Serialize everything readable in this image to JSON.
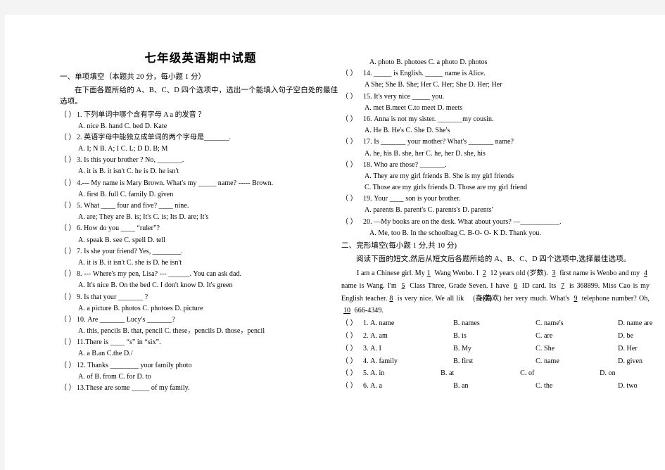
{
  "document": {
    "title": "七年级英语期中试题"
  },
  "section1": {
    "heading": "一、单项填空（本题共 20 分，每小题 1 分）",
    "instruction": "在下面各题所给的 A、B、C、D 四个选项中，选出一个能填入句子空白处的最佳选项。",
    "bracket": "（    ）",
    "questions": [
      {
        "num": "1.",
        "stem": "下列单词中哪个含有字母 A a 的发音 ？",
        "options": "A. nice          B. hand          C. bed              D. Kate"
      },
      {
        "num": "2.",
        "stem": "英语字母中能独立成单词的两个字母是_______.",
        "options": "A. I; N          B. A; I         C. L; D         D. B; M"
      },
      {
        "num": "3.",
        "stem": "Is this your brother ? No, _______.",
        "options": "A. it is          B. it isn't        C. he is       D. he isn't"
      },
      {
        "num": "4.---",
        "stem": "My name is Mary Brown. What's my _____ name?     ----- Brown.",
        "options": "A. first         B. full        C. family      D. given"
      },
      {
        "num": "5.",
        "stem": "What ____ four and five?      ____ nine.",
        "options": "A. are; They are     B. is; It's     C. is; Its     D. are; It's"
      },
      {
        "num": "6.",
        "stem": "How do you ____ “ruler”?",
        "options": "A. speak           B. see          C. spell        D. tell"
      },
      {
        "num": "7.",
        "stem": "Is she your friend? Yes, ________.",
        "options": "A. it is            B. it isn't         C. she is       D. he isn't"
      },
      {
        "num": "8. ---",
        "stem": "Where's my pen, Lisa?     --- ______. You can ask dad.",
        "options": "A. It's nice      B. On the bed    C. I don't know   D. It's green"
      },
      {
        "num": "9.",
        "stem": "Is that your _______ ?",
        "options": "A. a picture        B. photos       C. photoes        D. picture"
      },
      {
        "num": "10.",
        "stem": "Are _______ Lucy's _______?",
        "options": "A. this, pencils    B. that,  pencil     C. these，pencils    D. those，pencil"
      },
      {
        "num": "11.",
        "stem": "There is ____ “s” in “six”.",
        "options": "A. a              B.an          C.the            D./"
      },
      {
        "num": "12.",
        "stem": "Thanks ________ your family photo",
        "options": "A. of            B. from           C. for           D. to"
      },
      {
        "num": "13.",
        "stem": "These are some _____ of my family.",
        "options": "A. photo      B. photoes        C. a photo        D. photos"
      },
      {
        "num": "14.",
        "stem": "_____ is English.    _____ name is Alice.",
        "options": "A She; She           B. She; Her          C. Her; She      D. Her; Her"
      },
      {
        "num": "15.",
        "stem": "It's very nice _____ you.",
        "options": "A. met             B.meet         C.to meet               D. meets"
      },
      {
        "num": "16.",
        "stem": "Anna is not my sister. _______my cousin.",
        "options": "A. He     B. He's       C. She      D. She's"
      },
      {
        "num": "17.",
        "stem": "Is _______ your mother? What's _______ name?",
        "options": "A. he,  his       B. she,  her      C. he,  her       D. she,  his"
      },
      {
        "num": "18.",
        "stem": "Who are those? _______.",
        "options_line1": "A. They are my girl friends                B. She is my girl friends",
        "options_line2": "C. Those are my girls friends             D. Those are my girl friend"
      },
      {
        "num": "19.",
        "stem": "Your ____ son is your brother.",
        "options": "A. parents        B. parent's       C. parents's     D. parents'"
      },
      {
        "num": "20.",
        "stem": "—My books are on the desk. What about yours?       —___________.",
        "options": "A. Me, too    B. In the schoolbag   C. B-O- O- K     D. Thank you."
      }
    ]
  },
  "section2": {
    "heading": "二、完形填空(每小题 1 分,共 10 分)",
    "instruction": "阅读下面的短文,然后从短文后各题所给的 A、B、C、D 四个选项中,选择最佳选项。",
    "passage_line1_a": "I am a Chinese girl. My",
    "passage_blank1": "1",
    "passage_line1_b": "Wang Wenbo. I",
    "passage_blank2": "2",
    "passage_line1_c": "12 years old (岁数).",
    "passage_blank3": "3",
    "passage_line1_d": "first name is",
    "passage_line2_a": "Wenbo and my",
    "passage_blank4": "4",
    "passage_line2_b": "name is Wang. I'm",
    "passage_blank5": "5",
    "passage_line2_c": "Class Three, Grade Seven. I have",
    "passage_blank6": "6",
    "passage_line2_d": "ID card.",
    "passage_line3_a": "Its",
    "passage_blank7": "7",
    "passage_line3_b": "is 368899. Miss Cao is my English teacher.",
    "passage_blank8": "8",
    "passage_line3_c": "is very nice. We all lik",
    "passage_line3_overlap_under": "e(喜欢)",
    "passage_line3_overlap_over": "(喜欢)",
    "passage_line3_d": "her",
    "passage_line4_a": "very much. What's",
    "passage_blank9": "9",
    "passage_line4_b": "telephone number? Oh,",
    "passage_blank10": "10",
    "passage_line4_c": "666-4349.",
    "bracket": "（    ）",
    "questions": [
      {
        "num": "1.",
        "a": "A. name",
        "b": "B. names",
        "c": "C. name's",
        "d": "D. name are"
      },
      {
        "num": "2.",
        "a": "A. am",
        "b": "B. is",
        "c": "C. are",
        "d": "D. be"
      },
      {
        "num": "3.",
        "a": "A. I",
        "b": "B. My",
        "c": "C. She",
        "d": "D. Her"
      },
      {
        "num": "4.",
        "a": "A. family",
        "b": "B. first",
        "c": "C. name",
        "d": "D. given"
      },
      {
        "num": "5.",
        "a": "A. in",
        "b": "B. at",
        "c": "C. of",
        "d": "D. on"
      },
      {
        "num": "6.",
        "a": "A. a",
        "b": "B. an",
        "c": "C. the",
        "d": "D. two"
      }
    ]
  }
}
